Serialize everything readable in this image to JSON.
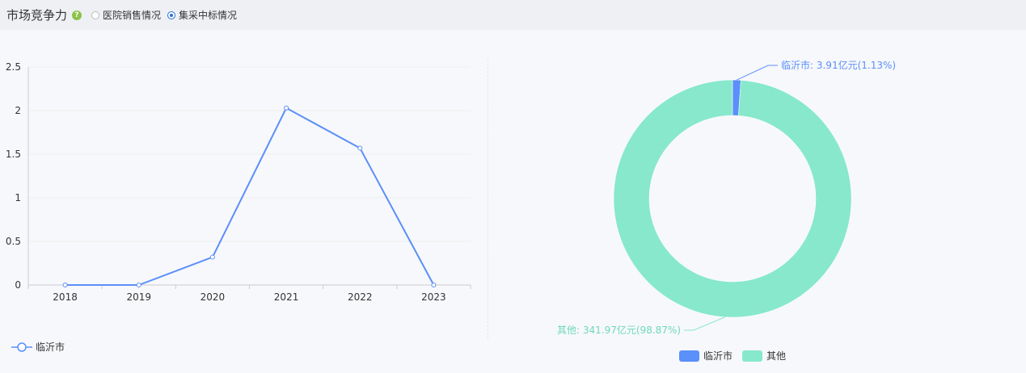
{
  "header": {
    "title": "市场竞争力",
    "help_icon": "question-circle-icon",
    "options": [
      {
        "label": "医院销售情况",
        "selected": false
      },
      {
        "label": "集采中标情况",
        "selected": true
      }
    ]
  },
  "colors": {
    "linyi": "#5b8ff9",
    "other": "#87e8cc",
    "axis": "#cccccc",
    "grid": "#eeeeee"
  },
  "chart_data": [
    {
      "type": "line",
      "x": [
        "2018",
        "2019",
        "2020",
        "2021",
        "2022",
        "2023"
      ],
      "series": [
        {
          "name": "临沂市",
          "values": [
            0,
            0,
            0.32,
            2.03,
            1.57,
            0
          ]
        }
      ],
      "ylim": [
        0,
        2.5
      ],
      "yticks": [
        "0",
        "0.5",
        "1",
        "1.5",
        "2",
        "2.5"
      ],
      "grid": true,
      "legend": "bottom-left"
    },
    {
      "type": "pie",
      "donut": true,
      "slices": [
        {
          "name": "临沂市",
          "value": 3.91,
          "label": "临沂市: 3.91亿元(1.13%)"
        },
        {
          "name": "其他",
          "value": 341.97,
          "label": "其他: 341.97亿元(98.87%)"
        }
      ],
      "legend": "bottom-center"
    }
  ]
}
